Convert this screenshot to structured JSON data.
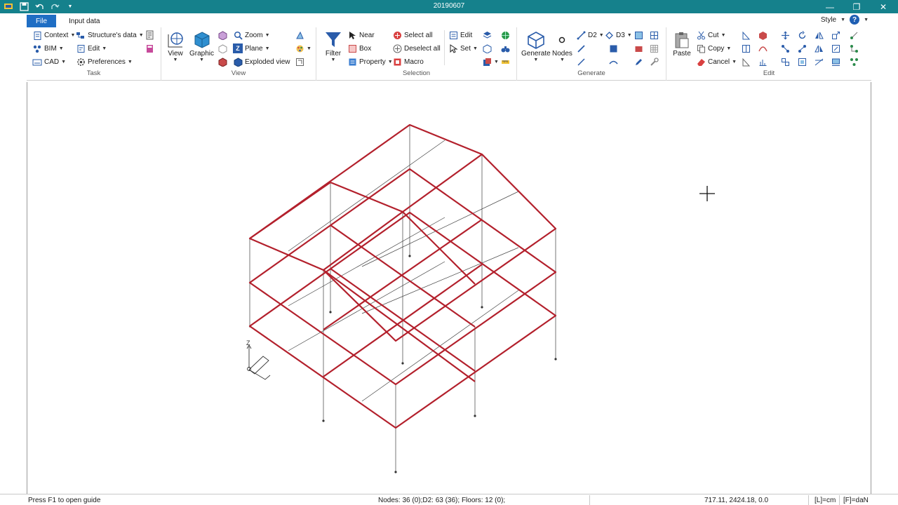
{
  "titlebar": {
    "title": "20190607",
    "bg": "#15818c",
    "minimize": "—",
    "maximize": "❐",
    "close": "✕"
  },
  "tabs": {
    "file": "File",
    "input_data": "Input data"
  },
  "style_menu": {
    "label": "Style"
  },
  "help": {
    "glyph": "?"
  },
  "ribbon": {
    "task": {
      "label": "Task",
      "context": "Context",
      "structures_data": "Structure's data",
      "bim": "BIM",
      "edit": "Edit",
      "cad": "CAD",
      "preferences": "Preferences"
    },
    "view": {
      "label": "View",
      "view": "View",
      "graphic": "Graphic",
      "zoom": "Zoom",
      "plane": "Plane",
      "exploded_view": "Exploded view",
      "plane_badge": "Z"
    },
    "selection": {
      "label": "Selection",
      "filter": "Filter",
      "near": "Near",
      "box": "Box",
      "property": "Property",
      "select_all": "Select all",
      "deselect_all": "Deselect all",
      "macro": "Macro",
      "edit": "Edit",
      "set": "Set"
    },
    "generate": {
      "label": "Generate",
      "generate": "Generate",
      "nodes": "Nodes",
      "d2": "D2",
      "d3": "D3"
    },
    "edit": {
      "label": "Edit",
      "paste": "Paste",
      "cut": "Cut",
      "copy": "Copy",
      "cancel": "Cancel"
    }
  },
  "viewport": {
    "axis_label": "Z",
    "frame_color": "#b3202c"
  },
  "status": {
    "guide": "Press F1 to open guide",
    "counts": "Nodes: 36 (0);D2: 63 (36); Floors: 12 (0);",
    "coords": "717.11, 2424.18, 0.0",
    "length_unit": "[L]=cm",
    "force_unit": "[F]=daN"
  }
}
